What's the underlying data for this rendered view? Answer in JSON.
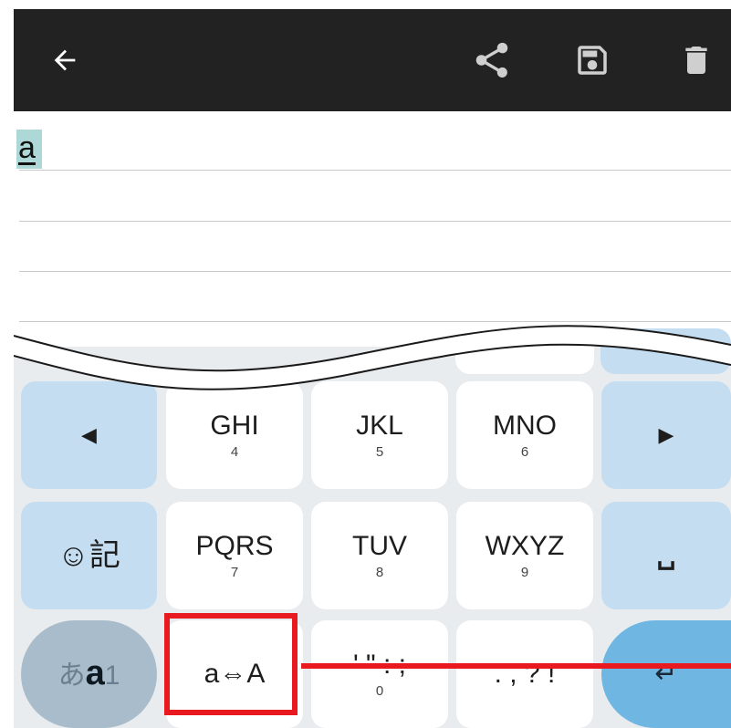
{
  "toolbar": {
    "back_icon": "arrow-back-icon",
    "share_icon": "share-icon",
    "save_icon": "save-icon",
    "delete_icon": "trash-icon"
  },
  "editor": {
    "text": "a"
  },
  "keyboard": {
    "row1": {
      "left": "◀",
      "ghi": {
        "label": "GHI",
        "num": "4"
      },
      "jkl": {
        "label": "JKL",
        "num": "5"
      },
      "mno": {
        "label": "MNO",
        "num": "6"
      },
      "right": "▶"
    },
    "row2": {
      "emoji": "☺記",
      "pqrs": {
        "label": "PQRS",
        "num": "7"
      },
      "tuv": {
        "label": "TUV",
        "num": "8"
      },
      "wxyz": {
        "label": "WXYZ",
        "num": "9"
      },
      "space": "␣"
    },
    "row3": {
      "mode": {
        "a": "あ",
        "b": "a",
        "c": "1"
      },
      "case": "a⇔A",
      "punct1": {
        "label": "' \" : ;",
        "num": "0"
      },
      "punct2": ". , ? !",
      "enter": "↵"
    }
  },
  "colors": {
    "appbar": "#222222",
    "key_blue": "#c5ddf0",
    "enter_blue": "#6fb6e3",
    "highlight": "#e8191f"
  }
}
